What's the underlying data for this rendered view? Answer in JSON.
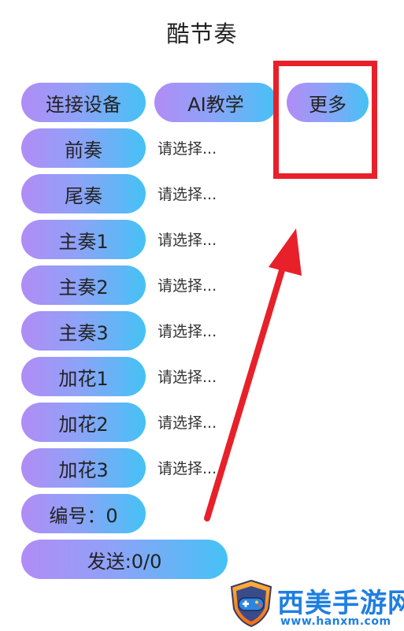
{
  "header": {
    "title": "酷节奏"
  },
  "top_buttons": {
    "connect_label": "连接设备",
    "ai_label": "AI教学",
    "more_label": "更多"
  },
  "rows": [
    {
      "label": "前奏",
      "value": "请选择..."
    },
    {
      "label": "尾奏",
      "value": "请选择..."
    },
    {
      "label": "主奏1",
      "value": "请选择..."
    },
    {
      "label": "主奏2",
      "value": "请选择..."
    },
    {
      "label": "主奏3",
      "value": "请选择..."
    },
    {
      "label": "加花1",
      "value": "请选择..."
    },
    {
      "label": "加花2",
      "value": "请选择..."
    },
    {
      "label": "加花3",
      "value": "请选择..."
    }
  ],
  "number_button": {
    "label": "编号：0"
  },
  "send_button": {
    "label": "发送:0/0"
  },
  "annotation": {
    "color": "#e8202a"
  },
  "watermark": {
    "name": "西美手游网",
    "url": "www.hanxm.com",
    "icon": "gamepad-shield-icon"
  },
  "colors": {
    "gradient_start": "#b18cf6",
    "gradient_end": "#44c2f5",
    "brand_blue": "#1f7fe0"
  }
}
